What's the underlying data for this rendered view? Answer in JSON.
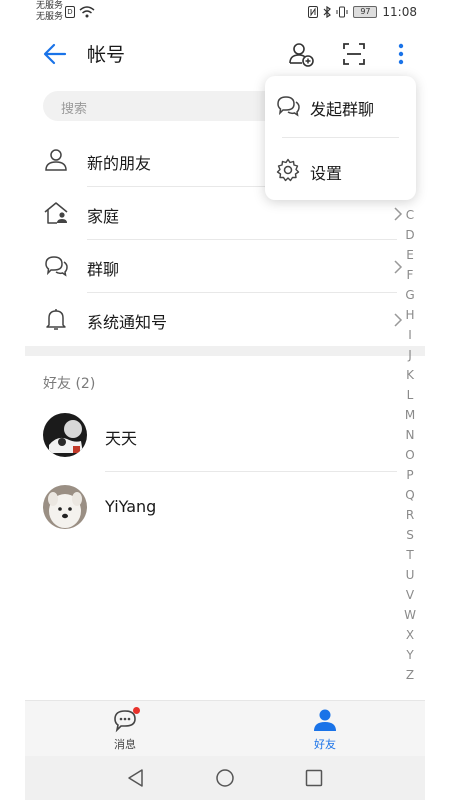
{
  "statusbar": {
    "carrier_line1": "无服务",
    "carrier_line2": "无服务",
    "sim_label": "D",
    "battery": "97",
    "time": "11:08"
  },
  "appbar": {
    "title": "帐号"
  },
  "search": {
    "placeholder": "搜索"
  },
  "menu_items": [
    {
      "label": "新的朋友",
      "icon": "person-icon"
    },
    {
      "label": "家庭",
      "icon": "home-icon"
    },
    {
      "label": "群聊",
      "icon": "chat-bubbles-icon"
    },
    {
      "label": "系统通知号",
      "icon": "bell-icon"
    }
  ],
  "friends": {
    "header": "好友 (2)",
    "list": [
      {
        "name": "天天"
      },
      {
        "name": "YiYang"
      }
    ]
  },
  "alpha_index": [
    "C",
    "D",
    "E",
    "F",
    "G",
    "H",
    "I",
    "J",
    "K",
    "L",
    "M",
    "N",
    "O",
    "P",
    "Q",
    "R",
    "S",
    "T",
    "U",
    "V",
    "W",
    "X",
    "Y",
    "Z"
  ],
  "popup_menu": [
    {
      "label": "发起群聊",
      "icon": "chat-bubbles-icon"
    },
    {
      "label": "设置",
      "icon": "gear-icon"
    }
  ],
  "bottomnav": {
    "messages_label": "消息",
    "friends_label": "好友"
  },
  "colors": {
    "accent": "#1a73e8",
    "badge": "#e8322b"
  }
}
